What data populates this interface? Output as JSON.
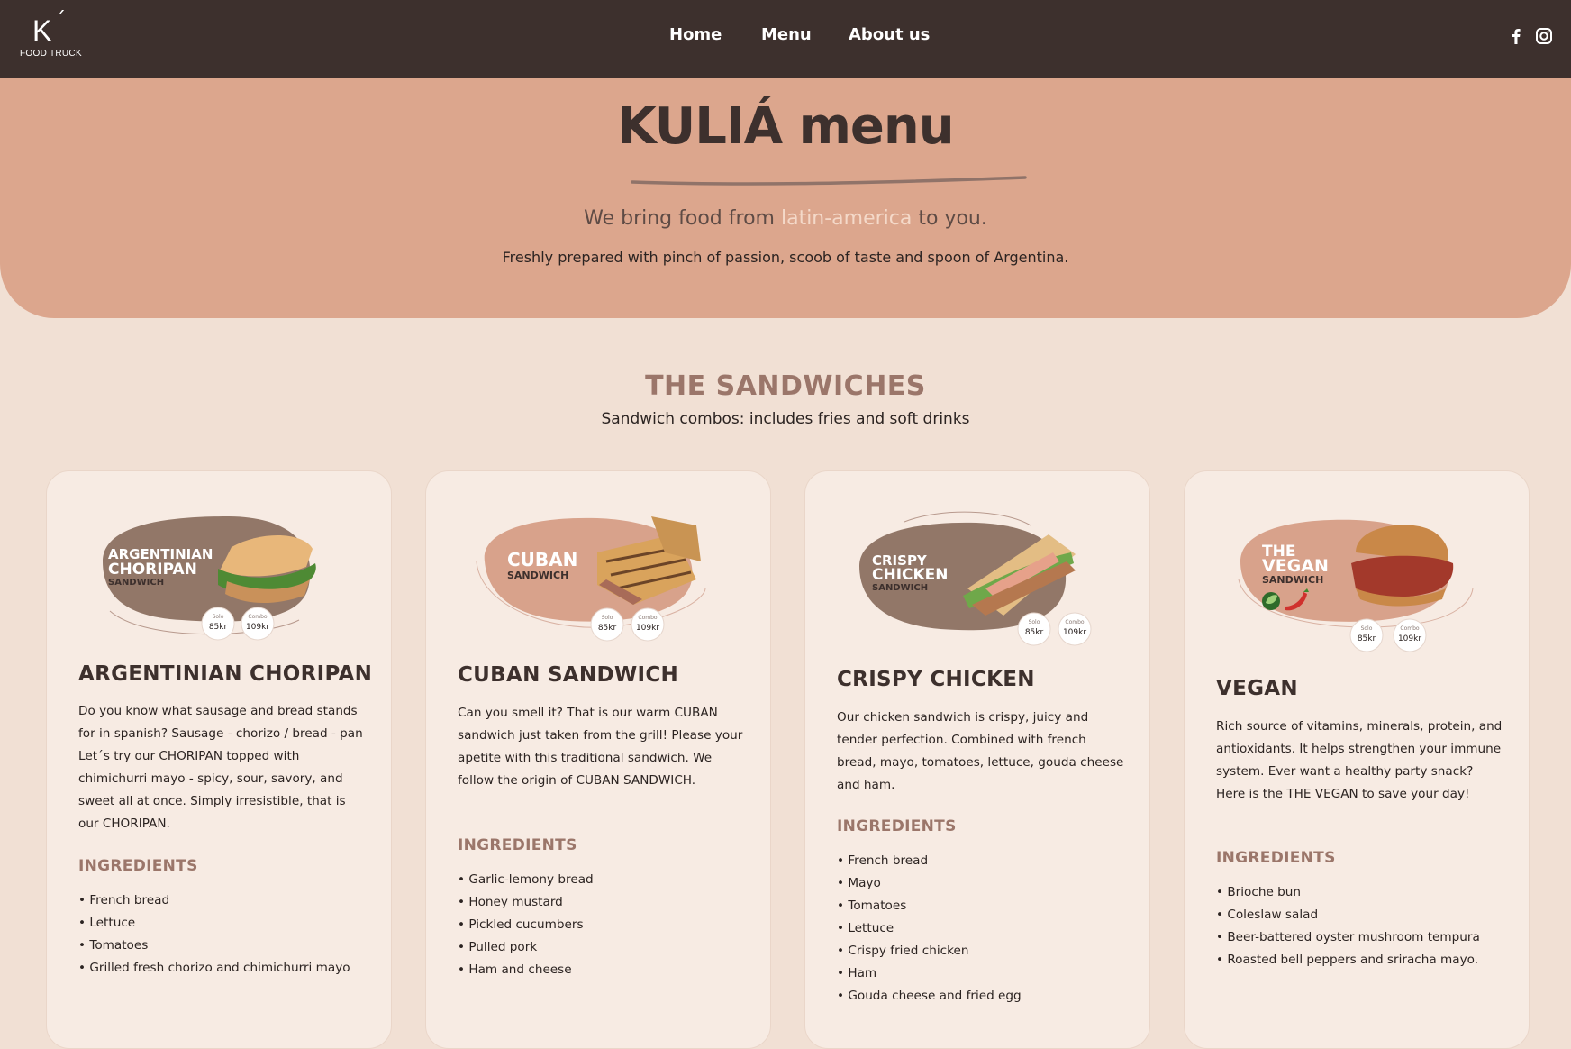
{
  "nav": {
    "logo_letter": "K",
    "logo_accent": "´",
    "logo_subtitle": "FOOD TRUCK",
    "links": [
      "Home",
      "Menu",
      "About us"
    ],
    "social_icons": [
      "facebook-icon",
      "instagram-icon"
    ]
  },
  "hero": {
    "title": "KULIÁ menu",
    "tagline_pre": "We bring food from ",
    "tagline_highlight": "latin-america",
    "tagline_post": " to you.",
    "description": "Freshly prepared with pinch of passion, scoob of taste and spoon of Argentina."
  },
  "section": {
    "title": "THE SANDWICHES",
    "subtitle": "Sandwich combos: includes fries and soft drinks"
  },
  "cards": [
    {
      "badge_line1": "ARGENTINIAN",
      "badge_line2": "CHORIPAN",
      "badge_line3": "SANDWICH",
      "solo_label": "Solo",
      "solo_price": "85kr",
      "combo_label": "Combo",
      "combo_price": "109kr",
      "title": "ARGENTINIAN CHORIPAN",
      "description": "Do you know what sausage and bread stands for in spanish? Sausage - chorizo / bread - pan Let´s try our CHORIPAN topped with chimichurri mayo - spicy, sour, savory, and sweet all at once. Simply irresistible, that is our CHORIPAN.",
      "ingredients_label": "INGREDIENTS",
      "ingredients": [
        "French bread",
        "Lettuce",
        "Tomatoes",
        "Grilled fresh chorizo and chimichurri mayo"
      ]
    },
    {
      "badge_line1": "CUBAN",
      "badge_line2": "SANDWICH",
      "solo_label": "Solo",
      "solo_price": "85kr",
      "combo_label": "Combo",
      "combo_price": "109kr",
      "title": "CUBAN SANDWICH",
      "description": "Can you smell it? That is our warm CUBAN sandwich just taken from the grill! Please your apetite with this traditional sandwich. We follow the origin of CUBAN SANDWICH.",
      "ingredients_label": "INGREDIENTS",
      "ingredients": [
        "Garlic-lemony bread",
        "Honey mustard",
        "Pickled cucumbers",
        "Pulled pork",
        "Ham and cheese"
      ]
    },
    {
      "badge_line1": "CRISPY",
      "badge_line2": "CHICKEN",
      "badge_line3": "SANDWICH",
      "solo_label": "Solo",
      "solo_price": "85kr",
      "combo_label": "Combo",
      "combo_price": "109kr",
      "title": "CRISPY CHICKEN",
      "description": "Our chicken sandwich is crispy, juicy and tender perfection. Combined with french bread, mayo, tomatoes, lettuce, gouda cheese and ham.",
      "ingredients_label": "INGREDIENTS",
      "ingredients": [
        "French bread",
        "Mayo",
        "Tomatoes",
        "Lettuce",
        "Crispy fried chicken",
        "Ham",
        "Gouda cheese and fried egg"
      ]
    },
    {
      "badge_line1": "THE",
      "badge_line2": "VEGAN",
      "badge_line3": "SANDWICH",
      "solo_label": "Solo",
      "solo_price": "85kr",
      "combo_label": "Combo",
      "combo_price": "109kr",
      "title": "VEGAN",
      "description": "Rich source of vitamins, minerals, protein, and antioxidants. It helps strengthen your immune system. Ever want a healthy party snack? Here is the THE VEGAN to save your day!",
      "ingredients_label": "INGREDIENTS",
      "ingredients": [
        "Brioche bun",
        "Coleslaw salad",
        "Beer-battered oyster mushroom tempura",
        "Roasted bell peppers and sriracha mayo."
      ]
    }
  ],
  "colors": {
    "nav_bg": "#3d302d",
    "hero_bg": "#dca68d",
    "page_bg": "#f1e0d4",
    "card_bg": "#f7ebe3",
    "accent_brown": "#9b766a",
    "dark_blob": "#927768",
    "light_blob": "#d8a28b"
  }
}
